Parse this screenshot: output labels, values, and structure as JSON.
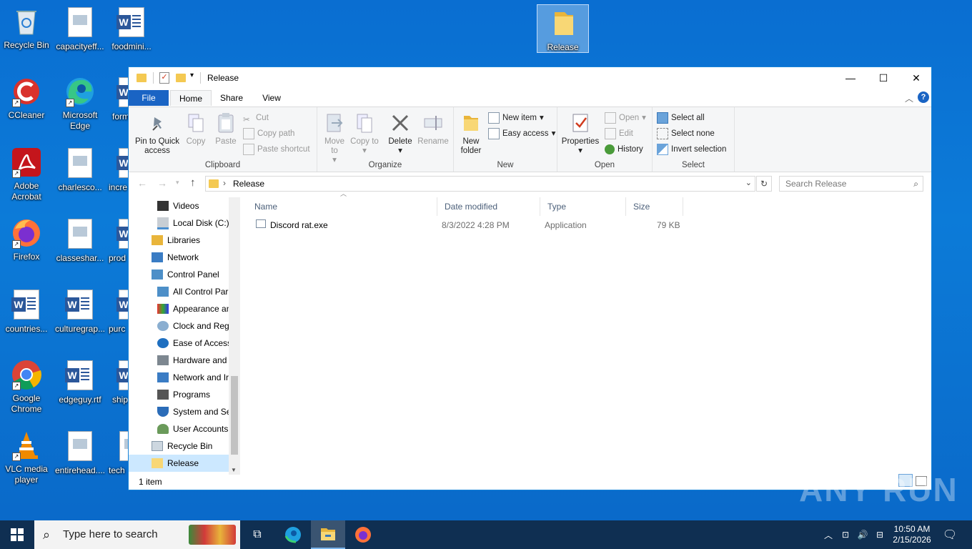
{
  "desktop": {
    "icons": [
      {
        "label": "Recycle Bin"
      },
      {
        "label": "capacityeff..."
      },
      {
        "label": "foodmini..."
      },
      {
        "label": "CCleaner"
      },
      {
        "label": "Microsoft Edge"
      },
      {
        "label": "form"
      },
      {
        "label": "Adobe Acrobat"
      },
      {
        "label": "charlesco..."
      },
      {
        "label": "incre"
      },
      {
        "label": "Firefox"
      },
      {
        "label": "classeshar..."
      },
      {
        "label": "prod"
      },
      {
        "label": "countries..."
      },
      {
        "label": "culturegrap..."
      },
      {
        "label": "purc"
      },
      {
        "label": "Google Chrome"
      },
      {
        "label": "edgeguy.rtf"
      },
      {
        "label": "ship"
      },
      {
        "label": "VLC media player"
      },
      {
        "label": "entirehead...."
      },
      {
        "label": "tech"
      },
      {
        "label": "Release"
      }
    ]
  },
  "window": {
    "title": "Release",
    "controls": {
      "minimize": "—",
      "maximize": "☐",
      "close": "✕"
    },
    "tabs": {
      "file": "File",
      "home": "Home",
      "share": "Share",
      "view": "View"
    },
    "ribbon": {
      "clipboard": {
        "label": "Clipboard",
        "pin": "Pin to Quick access",
        "copy": "Copy",
        "paste": "Paste",
        "cut": "Cut",
        "copy_path": "Copy path",
        "paste_shortcut": "Paste shortcut"
      },
      "organize": {
        "label": "Organize",
        "move_to": "Move to",
        "copy_to": "Copy to",
        "delete": "Delete",
        "rename": "Rename"
      },
      "new": {
        "label": "New",
        "new_folder": "New folder",
        "new_item": "New item",
        "easy_access": "Easy access"
      },
      "open": {
        "label": "Open",
        "properties": "Properties",
        "open": "Open",
        "edit": "Edit",
        "history": "History"
      },
      "select": {
        "label": "Select",
        "select_all": "Select all",
        "select_none": "Select none",
        "invert": "Invert selection"
      }
    },
    "address": {
      "path": "Release",
      "search_placeholder": "Search Release"
    },
    "nav": [
      {
        "label": "Videos"
      },
      {
        "label": "Local Disk (C:)"
      },
      {
        "label": "Libraries"
      },
      {
        "label": "Network"
      },
      {
        "label": "Control Panel"
      },
      {
        "label": "All Control Par"
      },
      {
        "label": "Appearance an"
      },
      {
        "label": "Clock and Regi"
      },
      {
        "label": "Ease of Access"
      },
      {
        "label": "Hardware and"
      },
      {
        "label": "Network and Ir"
      },
      {
        "label": "Programs"
      },
      {
        "label": "System and Se"
      },
      {
        "label": "User Accounts"
      },
      {
        "label": "Recycle Bin"
      },
      {
        "label": "Release"
      }
    ],
    "columns": {
      "name": "Name",
      "date": "Date modified",
      "type": "Type",
      "size": "Size"
    },
    "files": [
      {
        "name": "Discord rat.exe",
        "date": "8/3/2022 4:28 PM",
        "type": "Application",
        "size": "79 KB"
      }
    ],
    "status": "1 item"
  },
  "taskbar": {
    "search_placeholder": "Type here to search",
    "time": "10:50 AM",
    "date": "2/15/2026"
  },
  "watermark": "ANY RUN"
}
